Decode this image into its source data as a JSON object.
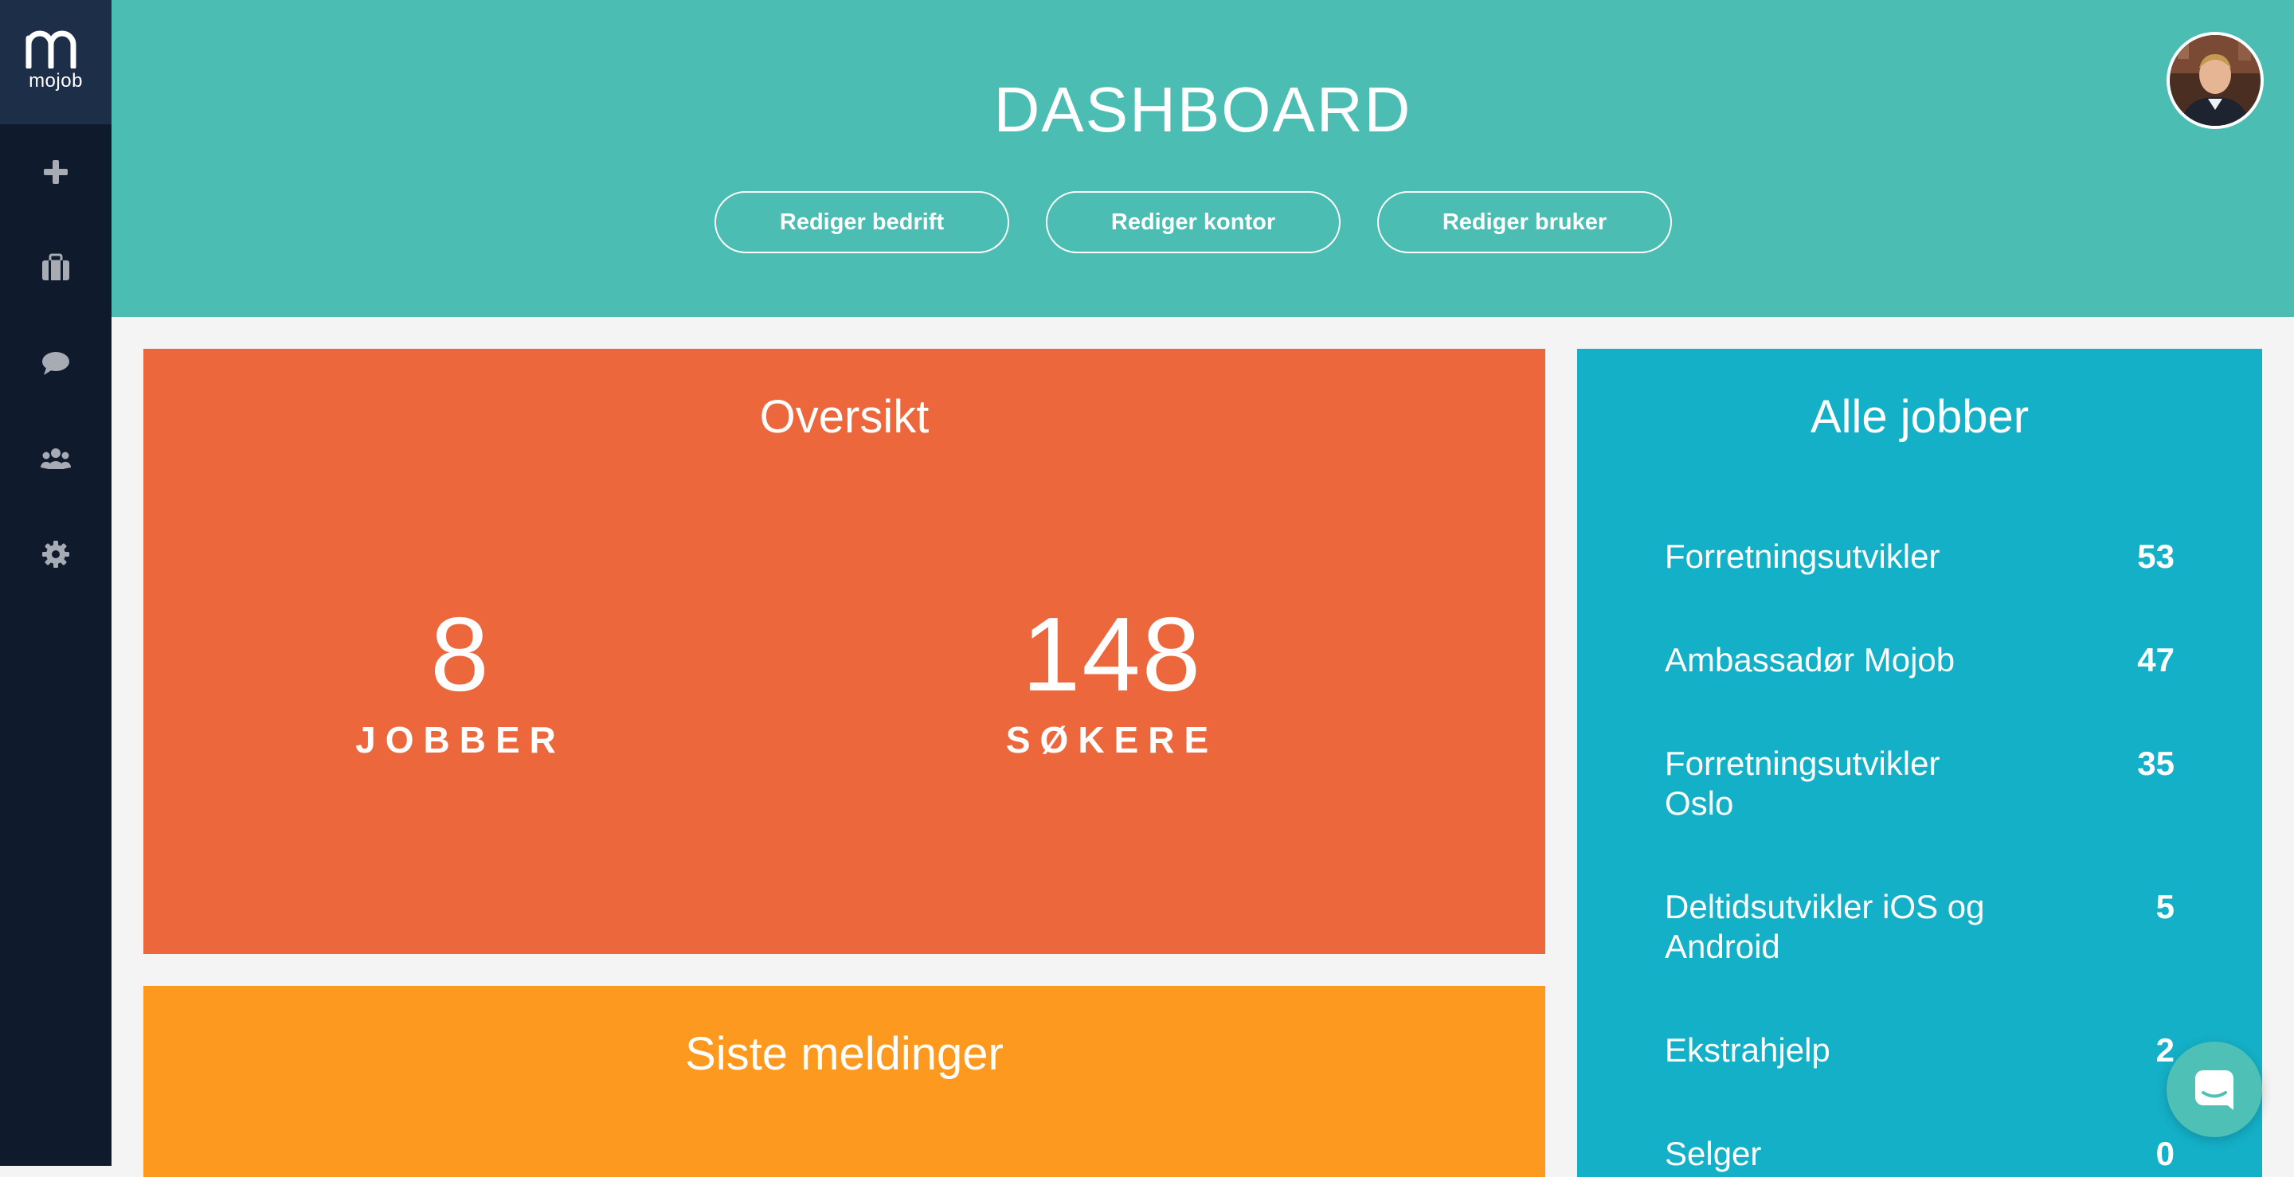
{
  "app": {
    "logo_text": "mojob"
  },
  "sidebar": {
    "items": [
      {
        "name": "add",
        "icon": "plus-icon"
      },
      {
        "name": "jobs",
        "icon": "briefcase-icon"
      },
      {
        "name": "messages",
        "icon": "chat-icon"
      },
      {
        "name": "candidates",
        "icon": "users-icon"
      },
      {
        "name": "settings",
        "icon": "gear-icon"
      }
    ]
  },
  "header": {
    "title": "DASHBOARD",
    "buttons": {
      "edit_company": "Rediger bedrift",
      "edit_office": "Rediger kontor",
      "edit_user": "Rediger bruker"
    }
  },
  "overview": {
    "title": "Oversikt",
    "jobs": {
      "value": "8",
      "label": "JOBBER"
    },
    "applicants": {
      "value": "148",
      "label": "SØKERE"
    }
  },
  "messages": {
    "title": "Siste meldinger"
  },
  "jobs": {
    "title": "Alle jobber",
    "items": [
      {
        "name": "Forretningsutvikler",
        "count": "53"
      },
      {
        "name": "Ambassadør Mojob",
        "count": "47"
      },
      {
        "name": "Forretningsutvikler Oslo",
        "count": "35"
      },
      {
        "name": "Deltidsutvikler iOS og Android",
        "count": "5"
      },
      {
        "name": "Ekstrahjelp",
        "count": "2"
      },
      {
        "name": "Selger",
        "count": "0"
      }
    ]
  },
  "colors": {
    "sidebar": "#0f1a2c",
    "header": "#4bbdb3",
    "overview": "#ed673c",
    "messages": "#fd991f",
    "jobs": "#14b0c8"
  }
}
